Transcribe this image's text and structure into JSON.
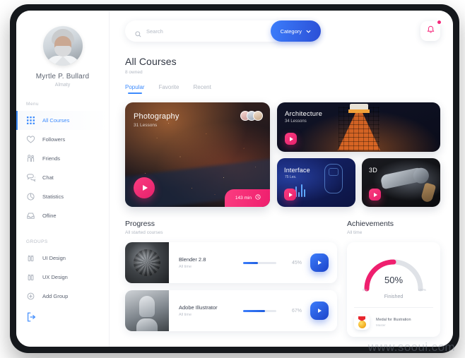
{
  "sidebar": {
    "user": {
      "name": "Myrtle P. Bullard",
      "location": "Almaty"
    },
    "menu_label": "Menu",
    "items": [
      {
        "label": "All Courses",
        "icon": "grid-icon",
        "active": true
      },
      {
        "label": "Followers",
        "icon": "heart-icon",
        "active": false
      },
      {
        "label": "Friends",
        "icon": "people-icon",
        "active": false
      },
      {
        "label": "Chat",
        "icon": "chat-icon",
        "active": false
      },
      {
        "label": "Statistics",
        "icon": "pie-chart-icon",
        "active": false
      },
      {
        "label": "Ofline",
        "icon": "inbox-icon",
        "active": false
      }
    ],
    "groups_label": "GROUPS",
    "groups": [
      {
        "label": "UI Design",
        "icon": "group-icon"
      },
      {
        "label": "UX Design",
        "icon": "group-icon"
      },
      {
        "label": "Add Group",
        "icon": "plus-circle-icon"
      }
    ],
    "logout_icon": "logout-icon"
  },
  "header": {
    "search_placeholder": "Search",
    "search_value": "",
    "search_icon": "search-icon",
    "category_label": "Category",
    "category_caret": "chevron-down-icon",
    "bell_icon": "bell-icon",
    "has_notification": true
  },
  "main": {
    "title": "All Courses",
    "subtitle": "8 owned",
    "tabs": [
      {
        "label": "Popular",
        "active": true
      },
      {
        "label": "Favorite",
        "active": false
      },
      {
        "label": "Recent",
        "active": false
      }
    ],
    "courses": [
      {
        "title": "Photography",
        "lessons": "31 Lessons",
        "duration": "143 min",
        "duration_icon": "clock-icon",
        "play_icon": "play-icon"
      },
      {
        "title": "Architecture",
        "lessons": "34 Lessons",
        "play_icon": "play-icon"
      },
      {
        "title": "Interface",
        "lessons": "75 Les.",
        "play_icon": "play-icon"
      },
      {
        "title": "3D",
        "lessons": "",
        "play_icon": "play-icon"
      }
    ]
  },
  "progress": {
    "title": "Progress",
    "subtitle": "All started courses",
    "rows": [
      {
        "name": "Blender 2.8",
        "time": "All time",
        "percent_label": "45%",
        "percent": 45,
        "play_icon": "play-icon"
      },
      {
        "name": "Adobe Illustrator",
        "time": "All time",
        "percent_label": "67%",
        "percent": 67,
        "play_icon": "play-icon"
      }
    ]
  },
  "achievements": {
    "title": "Achievements",
    "subtitle": "All time",
    "gauge": {
      "percent_label": "50%",
      "percent": 50,
      "caption": "Finished",
      "min_label": "0%",
      "max_label": "100%"
    },
    "items": [
      {
        "name": "Medal for Illustration",
        "sub": "Master",
        "icon": "medal-icon"
      }
    ]
  },
  "watermark": "www.sooui.com",
  "colors": {
    "accent_blue": "#3d8bfd",
    "accent_pink": "#f5277a",
    "text_dark": "#2f3542",
    "text_muted": "#b2b8c2"
  }
}
